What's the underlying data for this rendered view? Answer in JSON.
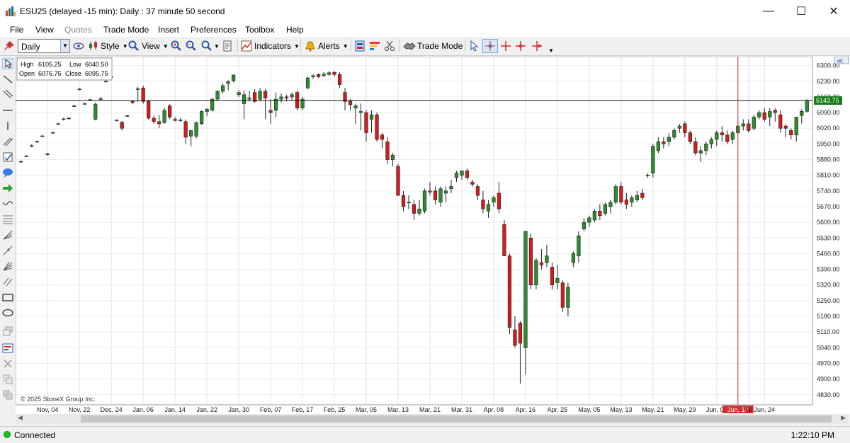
{
  "window": {
    "title": "ESU25 (delayed -15 min): Daily : 37 minute 50 second"
  },
  "menu": {
    "items": [
      "File",
      "View",
      "Quotes",
      "Trade Mode",
      "Insert",
      "Preferences",
      "Toolbox",
      "Help"
    ],
    "disabled": [
      "Quotes"
    ]
  },
  "toolbar": {
    "period_value": "Daily",
    "style_label": "Style",
    "view_label": "View",
    "indicators_label": "Indicators",
    "alerts_label": "Alerts",
    "trade_mode_label": "Trade Mode"
  },
  "ohlc": {
    "high_label": "High",
    "high": "6105.25",
    "low_label": "Low",
    "low": "6040.50",
    "open_label": "Open",
    "open": "6076.75",
    "close_label": "Close",
    "close": "6095.75"
  },
  "copyright": "© 2025 StoneX Group Inc.",
  "chart_data": {
    "type": "candlestick",
    "y_ticks": [
      6300,
      6230,
      6160,
      6090,
      6020,
      5950,
      5880,
      5810,
      5740,
      5670,
      5600,
      5530,
      5460,
      5390,
      5320,
      5250,
      5180,
      5110,
      5040,
      4970,
      4900,
      4830
    ],
    "y_tick_labels": [
      "6300.00",
      "6230.00",
      "6160.00",
      "6090.00",
      "6020.00",
      "5950.00",
      "5880.00",
      "5810.00",
      "5740.00",
      "5670.00",
      "5600.00",
      "5530.00",
      "5460.00",
      "5390.00",
      "5320.00",
      "5250.00",
      "5180.00",
      "5110.00",
      "5040.00",
      "4970.00",
      "4900.00",
      "4830.00"
    ],
    "ylim": [
      4785,
      6340
    ],
    "x_labels": [
      "Nov, 04",
      "Nov, 22",
      "Dec, 24",
      "Jan, 06",
      "Jan, 14",
      "Jan, 22",
      "Jan, 30",
      "Feb, 07",
      "Feb, 17",
      "Feb, 25",
      "Mar, 05",
      "Mar, 13",
      "Mar, 21",
      "Mar, 31",
      "Apr, 08",
      "Apr, 16",
      "Apr, 25",
      "May, 05",
      "May, 13",
      "May, 21",
      "May, 29",
      "Jun, 06",
      "Jun, 12",
      "16",
      "Jun, 24"
    ],
    "x_label_bar_index": [
      5,
      11,
      17,
      23,
      29,
      35,
      41,
      47,
      53,
      59,
      65,
      71,
      77,
      83,
      89,
      95,
      101,
      107,
      113,
      119,
      125,
      131,
      135,
      137,
      140
    ],
    "highlighted_x_label": "Jun, 12",
    "cursor_bar_index": 135,
    "last_price": 6143.75,
    "last_price_label": "6143.75",
    "ohlc": [
      [
        5872,
        5876,
        5866,
        5870
      ],
      [
        5896,
        5900,
        5892,
        5896
      ],
      [
        5942,
        5948,
        5936,
        5940
      ],
      [
        5960,
        5965,
        5955,
        5961
      ],
      [
        5985,
        5990,
        5980,
        5986
      ],
      [
        5906,
        5910,
        5898,
        5902
      ],
      [
        6000,
        6004,
        5996,
        6001
      ],
      [
        6040,
        6045,
        6035,
        6040
      ],
      [
        6060,
        6066,
        6055,
        6062
      ],
      [
        6065,
        6070,
        6060,
        6064
      ],
      [
        6120,
        6125,
        6115,
        6120
      ],
      [
        6195,
        6200,
        6190,
        6195
      ],
      [
        6130,
        6134,
        6126,
        6130
      ],
      [
        6147,
        6150,
        6143,
        6148
      ],
      [
        6060,
        6135,
        6055,
        6128
      ],
      [
        6150,
        6160,
        6146,
        6152
      ],
      [
        6230,
        6236,
        6226,
        6230
      ],
      [
        6250,
        6256,
        6245,
        6250
      ],
      [
        6056,
        6060,
        6052,
        6056
      ],
      [
        6047,
        6052,
        6010,
        6020
      ],
      [
        6075,
        6080,
        6070,
        6076
      ],
      [
        6140,
        6145,
        6128,
        6135
      ],
      [
        6195,
        6205,
        6138,
        6196
      ],
      [
        6200,
        6210,
        6130,
        6140
      ],
      [
        6140,
        6148,
        6058,
        6065
      ],
      [
        6065,
        6075,
        6040,
        6050
      ],
      [
        6050,
        6080,
        6020,
        6040
      ],
      [
        6045,
        6110,
        6040,
        6100
      ],
      [
        6120,
        6128,
        6060,
        6070
      ],
      [
        6060,
        6070,
        6050,
        6055
      ],
      [
        6055,
        6065,
        6048,
        6057
      ],
      [
        6050,
        6060,
        5950,
        5980
      ],
      [
        5985,
        6000,
        5940,
        6010
      ],
      [
        5985,
        6050,
        5975,
        6045
      ],
      [
        6040,
        6100,
        6035,
        6095
      ],
      [
        6095,
        6110,
        6075,
        6105
      ],
      [
        6100,
        6155,
        6095,
        6150
      ],
      [
        6150,
        6190,
        6140,
        6185
      ],
      [
        6185,
        6220,
        6175,
        6210
      ],
      [
        6220,
        6235,
        6190,
        6228
      ],
      [
        6232,
        6260,
        6225,
        6258
      ],
      [
        6170,
        6190,
        6160,
        6180
      ],
      [
        6130,
        6190,
        6060,
        6170
      ],
      [
        6150,
        6185,
        6140,
        6155
      ],
      [
        6180,
        6195,
        6135,
        6140
      ],
      [
        6150,
        6200,
        6140,
        6185
      ],
      [
        6185,
        6195,
        6060,
        6155
      ],
      [
        6100,
        6150,
        6040,
        6090
      ],
      [
        6100,
        6180,
        6070,
        6150
      ],
      [
        6150,
        6175,
        6135,
        6160
      ],
      [
        6160,
        6170,
        6140,
        6155
      ],
      [
        6160,
        6180,
        6145,
        6170
      ],
      [
        6180,
        6190,
        6100,
        6110
      ],
      [
        6110,
        6160,
        6100,
        6150
      ],
      [
        6200,
        6250,
        6195,
        6245
      ],
      [
        6250,
        6260,
        6240,
        6255
      ],
      [
        6260,
        6265,
        6245,
        6250
      ],
      [
        6255,
        6270,
        6250,
        6262
      ],
      [
        6260,
        6275,
        6255,
        6268
      ],
      [
        6270,
        6275,
        6250,
        6260
      ],
      [
        6260,
        6270,
        6200,
        6215
      ],
      [
        6180,
        6200,
        6100,
        6140
      ],
      [
        6140,
        6150,
        6100,
        6125
      ],
      [
        6110,
        6130,
        6040,
        6120
      ],
      [
        6090,
        6130,
        6010,
        6095
      ],
      [
        6090,
        6100,
        5960,
        6000
      ],
      [
        6060,
        6100,
        6000,
        6080
      ],
      [
        6080,
        6090,
        5960,
        5970
      ],
      [
        5990,
        6000,
        5930,
        5970
      ],
      [
        5960,
        5980,
        5860,
        5880
      ],
      [
        5880,
        5910,
        5850,
        5900
      ],
      [
        5850,
        5860,
        5750,
        5720
      ],
      [
        5720,
        5740,
        5650,
        5670
      ],
      [
        5690,
        5720,
        5660,
        5690
      ],
      [
        5680,
        5700,
        5610,
        5640
      ],
      [
        5640,
        5700,
        5630,
        5660
      ],
      [
        5650,
        5750,
        5640,
        5740
      ],
      [
        5740,
        5780,
        5720,
        5735
      ],
      [
        5740,
        5760,
        5680,
        5700
      ],
      [
        5690,
        5760,
        5670,
        5750
      ],
      [
        5730,
        5760,
        5690,
        5740
      ],
      [
        5750,
        5790,
        5730,
        5760
      ],
      [
        5800,
        5830,
        5780,
        5820
      ],
      [
        5810,
        5830,
        5790,
        5830
      ],
      [
        5830,
        5840,
        5790,
        5800
      ],
      [
        5780,
        5790,
        5760,
        5770
      ],
      [
        5760,
        5770,
        5700,
        5720
      ],
      [
        5700,
        5740,
        5640,
        5660
      ],
      [
        5650,
        5700,
        5620,
        5680
      ],
      [
        5690,
        5720,
        5670,
        5710
      ],
      [
        5730,
        5780,
        5640,
        5660
      ],
      [
        5590,
        5610,
        5450,
        5450
      ],
      [
        5450,
        5460,
        5100,
        5130
      ],
      [
        5120,
        5180,
        5040,
        5050
      ],
      [
        5150,
        5160,
        4880,
        5060
      ],
      [
        5040,
        5550,
        4920,
        5560
      ],
      [
        5530,
        5550,
        5300,
        5320
      ],
      [
        5320,
        5440,
        5300,
        5430
      ],
      [
        5420,
        5480,
        5390,
        5410
      ],
      [
        5420,
        5500,
        5400,
        5450
      ],
      [
        5400,
        5420,
        5300,
        5320
      ],
      [
        5330,
        5410,
        5300,
        5350
      ],
      [
        5330,
        5340,
        5200,
        5220
      ],
      [
        5220,
        5330,
        5180,
        5310
      ],
      [
        5420,
        5470,
        5400,
        5460
      ],
      [
        5450,
        5560,
        5420,
        5540
      ],
      [
        5570,
        5620,
        5560,
        5600
      ],
      [
        5600,
        5630,
        5580,
        5620
      ],
      [
        5610,
        5660,
        5600,
        5650
      ],
      [
        5650,
        5680,
        5610,
        5630
      ],
      [
        5640,
        5690,
        5630,
        5680
      ],
      [
        5670,
        5700,
        5640,
        5690
      ],
      [
        5690,
        5770,
        5680,
        5760
      ],
      [
        5760,
        5780,
        5680,
        5690
      ],
      [
        5700,
        5730,
        5660,
        5680
      ],
      [
        5690,
        5720,
        5670,
        5710
      ],
      [
        5700,
        5740,
        5690,
        5720
      ],
      [
        5730,
        5750,
        5700,
        5710
      ],
      [
        5810,
        5820,
        5800,
        5810
      ],
      [
        5820,
        5950,
        5800,
        5940
      ],
      [
        5920,
        5980,
        5910,
        5960
      ],
      [
        5960,
        5980,
        5930,
        5950
      ],
      [
        5960,
        6000,
        5940,
        5980
      ],
      [
        5980,
        6020,
        5970,
        6010
      ],
      [
        6020,
        6040,
        6000,
        6030
      ],
      [
        6040,
        6050,
        5980,
        6000
      ],
      [
        6000,
        6010,
        5950,
        5960
      ],
      [
        5960,
        5980,
        5900,
        5910
      ],
      [
        5910,
        5940,
        5870,
        5920
      ],
      [
        5920,
        5960,
        5900,
        5950
      ],
      [
        5950,
        5980,
        5930,
        5970
      ],
      [
        5970,
        6010,
        5940,
        6000
      ],
      [
        6000,
        6030,
        5960,
        5990
      ],
      [
        5990,
        6010,
        5950,
        5960
      ],
      [
        5970,
        6010,
        5950,
        6000
      ],
      [
        6000,
        6050,
        5990,
        6030
      ],
      [
        6030,
        6060,
        6010,
        6040
      ],
      [
        6040,
        6060,
        6000,
        6010
      ],
      [
        6020,
        6080,
        6010,
        6070
      ],
      [
        6070,
        6100,
        6060,
        6090
      ],
      [
        6090,
        6110,
        6050,
        6060
      ],
      [
        6070,
        6110,
        6030,
        6095
      ],
      [
        6100,
        6110,
        6050,
        6090
      ],
      [
        6080,
        6100,
        6000,
        6020
      ],
      [
        6030,
        6040,
        5980,
        6020
      ],
      [
        6010,
        6020,
        5970,
        5990
      ],
      [
        5990,
        6040,
        5960,
        6070
      ],
      [
        6076.75,
        6105.25,
        6040.5,
        6095.75
      ],
      [
        6095.75,
        6150,
        6090,
        6143.75
      ]
    ]
  }
}
